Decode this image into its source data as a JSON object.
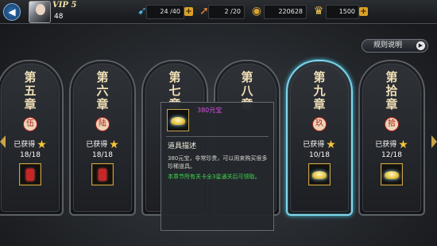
{
  "header": {
    "vip": "VIP 5",
    "level": "48",
    "stamina": "24 /40",
    "energy": "2 /20",
    "coins": "220628",
    "gold": "1500"
  },
  "rules_button": "规则说明",
  "chapters": [
    {
      "title": "第五章",
      "seal": "伍",
      "status": "已获得",
      "progress": "18/18",
      "reward": "red"
    },
    {
      "title": "第六章",
      "seal": "陆",
      "status": "已获得",
      "progress": "18/18",
      "reward": "red"
    },
    {
      "title": "第七章",
      "seal": "",
      "status": "",
      "progress": "",
      "reward": ""
    },
    {
      "title": "第八章",
      "seal": "",
      "status": "",
      "progress": "",
      "reward": ""
    },
    {
      "title": "第九章",
      "seal": "玖",
      "status": "已获得",
      "progress": "10/18",
      "reward": "ingot"
    },
    {
      "title": "第拾章",
      "seal": "拾",
      "status": "已获得",
      "progress": "12/18",
      "reward": "ingot"
    }
  ],
  "tooltip": {
    "item_name": "380元宝",
    "heading": "道具描述",
    "description": "380元宝，非常珍贵，可以用来购买很多珍稀道具。",
    "note": "本章节所有关卡全3星通关后可领取。"
  },
  "colors": {
    "accent_gold": "#c9a448",
    "selected_glow": "#7fd8ea",
    "item_name": "#d84fe2",
    "note_green": "#3fd64a"
  },
  "icons": [
    "back-arrow-icon",
    "stamina-icon",
    "energy-icon",
    "coin-icon",
    "gold-ingot-icon",
    "plus-icon",
    "star-icon",
    "chevron-right-icon"
  ]
}
